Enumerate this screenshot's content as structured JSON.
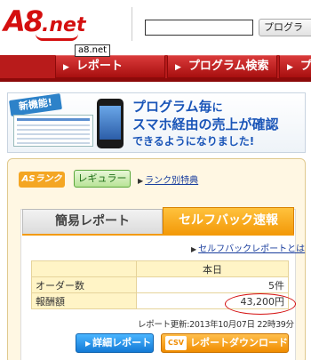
{
  "header": {
    "logo_main": "A8",
    "logo_suffix": ".net",
    "tooltip": "a8.net",
    "search_placeholder": "",
    "program_button_label": "プログラ"
  },
  "nav": {
    "tabs": [
      {
        "label": "レポート"
      },
      {
        "label": "プログラム検索"
      },
      {
        "label": "プ"
      }
    ]
  },
  "banner": {
    "badge": "新機能!",
    "line1_strong": "プログラム毎",
    "line1_rest": "に",
    "line2": "スマホ経由の売上が確認",
    "line3": "できるようになりました!"
  },
  "rank": {
    "badge": "ASランク",
    "level": "レギュラー",
    "link": "ランク別特典"
  },
  "tabs": {
    "simple": "簡易レポート",
    "selfback": "セルフバック速報"
  },
  "selfback_link": "セルフバックレポートとは",
  "report": {
    "header": "本日",
    "rows": [
      {
        "label": "オーダー数",
        "value": "5件"
      },
      {
        "label": "報酬額",
        "value": "43,200円"
      }
    ]
  },
  "update_text": "レポート更新:2013年10月07日 22時39分",
  "buttons": {
    "detail": "詳細レポート",
    "csv_tag": "CSV",
    "download": "レポートダウンロード"
  },
  "colors": {
    "brand_red": "#d40f0f",
    "nav_red": "#b81b1b",
    "orange": "#f39a0a",
    "blue": "#1a55b8"
  }
}
